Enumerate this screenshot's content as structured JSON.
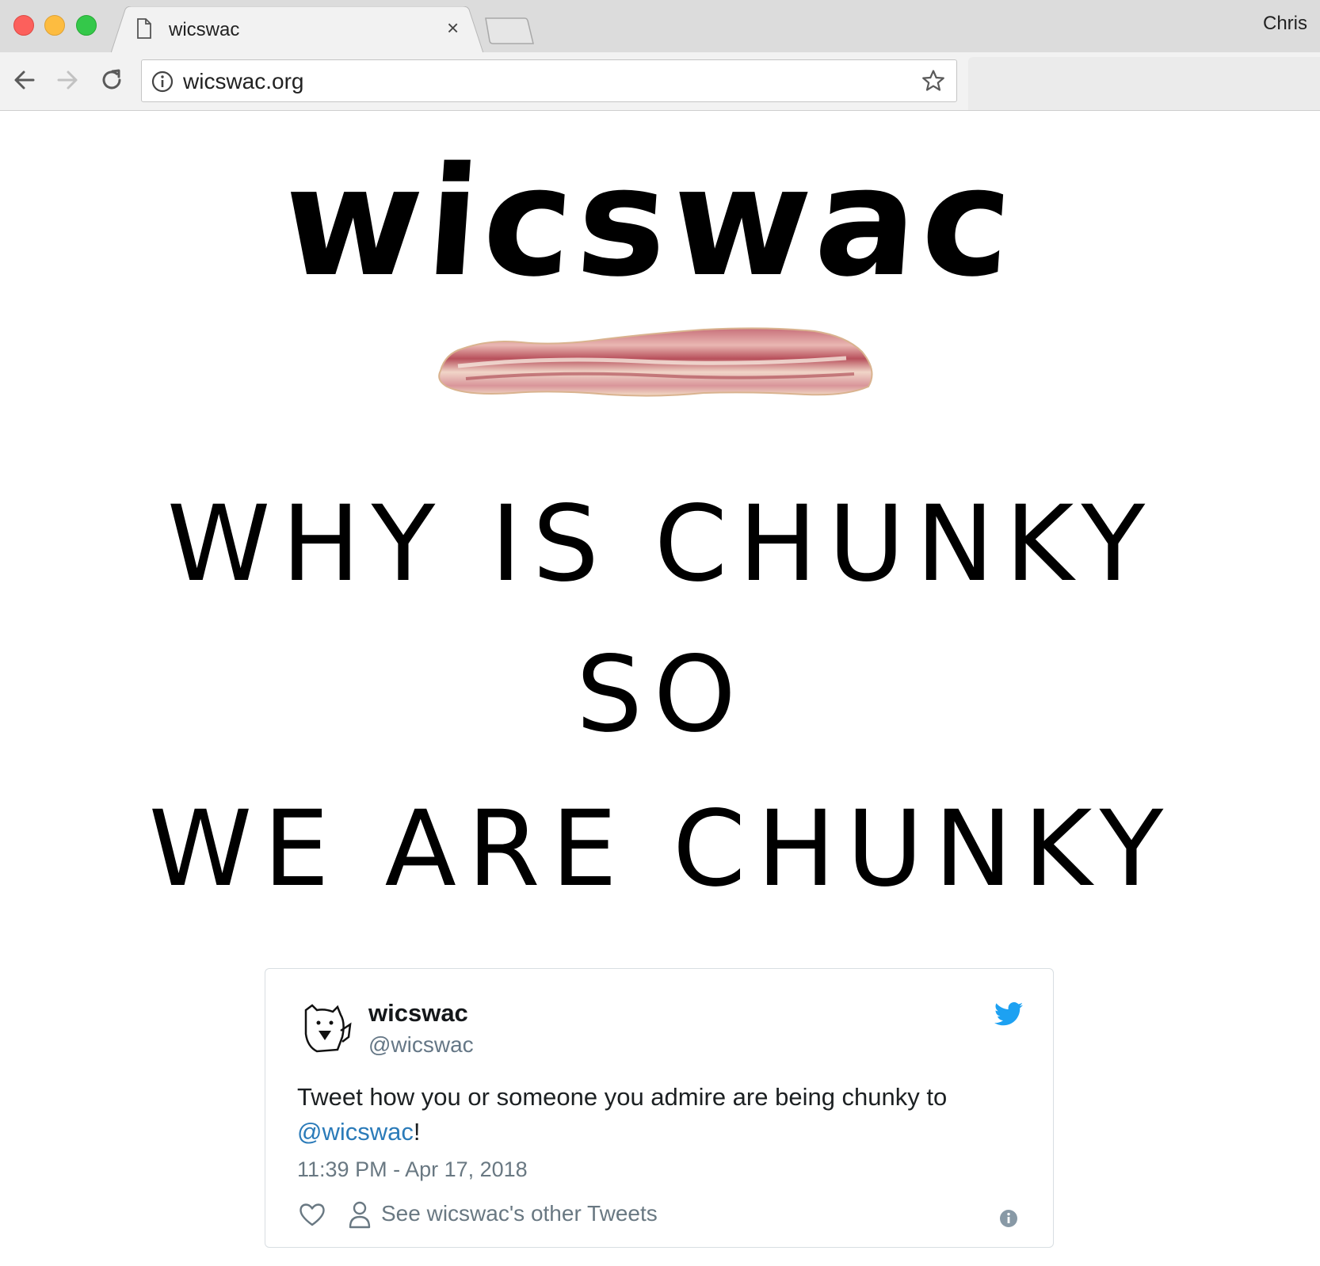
{
  "browser": {
    "tab_title": "wicswac",
    "tab_close": "×",
    "profile_name": "Chris",
    "url": "wicswac.org"
  },
  "page": {
    "logo_text": "wicswac",
    "slogan_line1": "WHY IS CHUNKY",
    "slogan_line2": "SO",
    "slogan_line3": "WE ARE CHUNKY"
  },
  "tweet": {
    "display_name": "wicswac",
    "handle": "@wicswac",
    "text_before": "Tweet how you or someone you admire are being chunky to",
    "mention": "@wicswac",
    "text_after": "!",
    "timestamp": "11:39 PM - Apr 17, 2018",
    "other_tweets_label": "See wicswac's other Tweets",
    "brand_color": "#1da1f2",
    "link_color": "#2b7bb9"
  }
}
